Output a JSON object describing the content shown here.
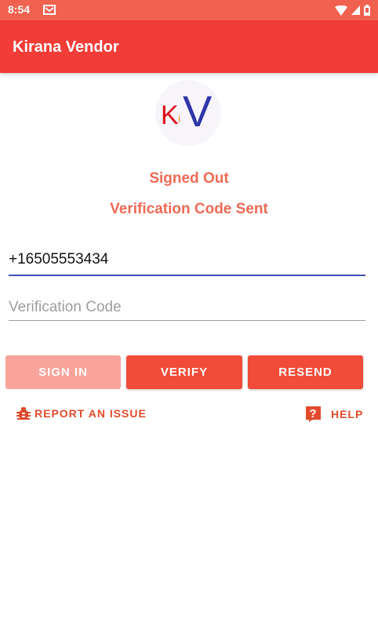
{
  "status_bar": {
    "time": "8:54",
    "notification_icon": "mail-icon",
    "system_icons": [
      "wifi-icon",
      "signal-icon",
      "battery-icon"
    ]
  },
  "app_bar": {
    "title": "Kirana Vendor"
  },
  "logo": {
    "k": "K",
    "i": "i",
    "v": "V"
  },
  "messages": {
    "signed_out": "Signed Out",
    "code_sent": "Verification Code Sent"
  },
  "form": {
    "phone_value": "+16505553434",
    "verification_placeholder": "Verification Code"
  },
  "buttons": {
    "sign_in": "SIGN IN",
    "verify": "VERIFY",
    "resend": "RESEND"
  },
  "links": {
    "report_issue": "REPORT AN ISSUE",
    "help": "HELP"
  },
  "colors": {
    "status_bar": "#f0614f",
    "app_bar": "#f13c37",
    "button": "#f04c39",
    "button_disabled": "#f8a49a",
    "message_text": "#ef6a55",
    "link_text": "#e14b2b",
    "input_focus_line": "#3f51b5"
  }
}
